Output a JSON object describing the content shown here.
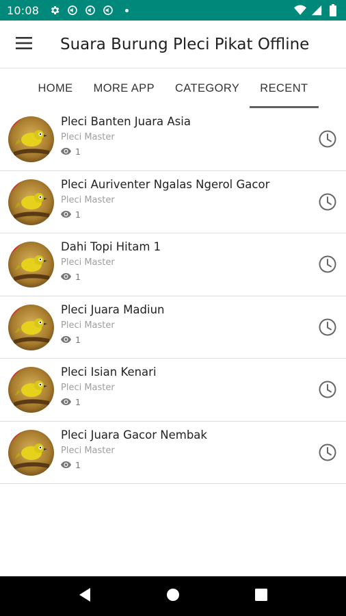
{
  "status_bar": {
    "time": "10:08",
    "icons": [
      "settings-icon",
      "volume-icon",
      "volume-icon",
      "volume-icon"
    ],
    "right_icons": [
      "wifi-icon",
      "signal-icon",
      "battery-icon"
    ]
  },
  "app_bar": {
    "title": "Suara Burung Pleci Pikat Offline",
    "menu_icon": "hamburger-menu-icon"
  },
  "tabs": [
    {
      "label": "HOME",
      "active": false
    },
    {
      "label": "MORE APP",
      "active": false
    },
    {
      "label": "CATEGORY",
      "active": false
    },
    {
      "label": "RECENT",
      "active": true
    }
  ],
  "items": [
    {
      "title": "Pleci Banten Juara Asia",
      "subtitle": "Pleci Master",
      "views": "1"
    },
    {
      "title": "Pleci Auriventer Ngalas Ngerol Gacor",
      "subtitle": "Pleci Master",
      "views": "1"
    },
    {
      "title": "Dahi Topi Hitam 1",
      "subtitle": "Pleci Master",
      "views": "1"
    },
    {
      "title": "Pleci Juara Madiun",
      "subtitle": "Pleci Master",
      "views": "1"
    },
    {
      "title": "Pleci Isian Kenari",
      "subtitle": "Pleci Master",
      "views": "1"
    },
    {
      "title": "Pleci Juara Gacor Nembak",
      "subtitle": "Pleci Master",
      "views": "1"
    }
  ],
  "colors": {
    "status_bar": "#00897B",
    "tab_indicator": "#616161",
    "nav_bar": "#000000"
  },
  "nav_bar": {
    "icons": [
      "back-icon",
      "home-icon",
      "recents-icon"
    ]
  }
}
